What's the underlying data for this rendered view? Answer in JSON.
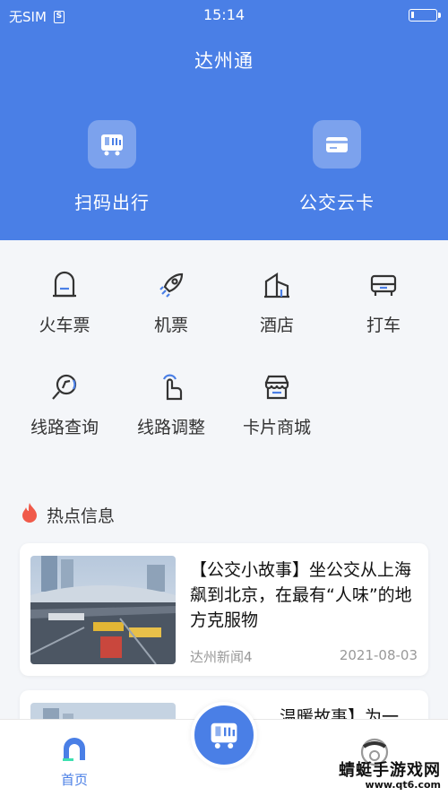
{
  "status_bar": {
    "carrier": "无SIM",
    "sim_icon_text": "S",
    "time": "15:14"
  },
  "header": {
    "title": "达州通"
  },
  "hero_actions": [
    {
      "label": "扫码出行",
      "icon": "bus-scan-icon"
    },
    {
      "label": "公交云卡",
      "icon": "card-icon"
    }
  ],
  "quick_grid": [
    {
      "label": "火车票",
      "icon": "train-icon"
    },
    {
      "label": "机票",
      "icon": "rocket-plane-icon"
    },
    {
      "label": "酒店",
      "icon": "hotel-icon"
    },
    {
      "label": "打车",
      "icon": "taxi-icon"
    },
    {
      "label": "线路查询",
      "icon": "route-search-icon"
    },
    {
      "label": "线路调整",
      "icon": "touch-adjust-icon"
    },
    {
      "label": "卡片商城",
      "icon": "shop-icon"
    }
  ],
  "hot_info": {
    "title": "热点信息",
    "news": [
      {
        "title": "【公交小故事】坐公交从上海飙到北京，在最有“人味”的地方克服物",
        "source": "达州新闻4",
        "date": "2021-08-03"
      },
      {
        "title": "温暖故事】为一",
        "source": "",
        "date": ""
      }
    ]
  },
  "tabbar": {
    "home_label": "首页"
  },
  "watermark": {
    "main": "蜻蜓手游戏网",
    "sub": "www.qt6.com"
  },
  "colors": {
    "primary": "#4a7fe6",
    "background": "#f4f6f9",
    "hot_icon": "#f05a4a"
  }
}
